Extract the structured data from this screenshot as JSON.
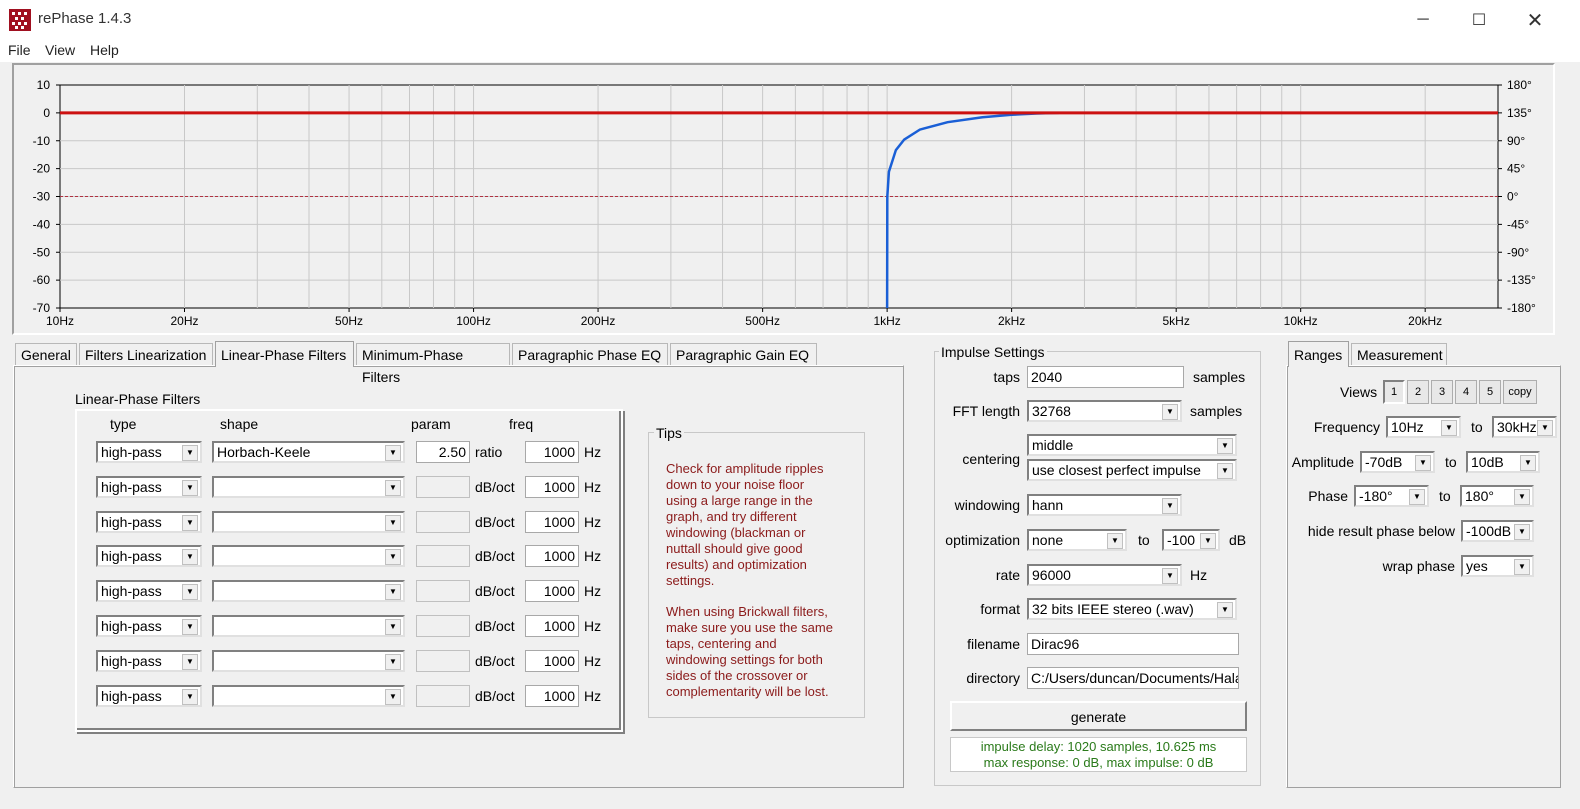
{
  "window": {
    "title": "rePhase 1.4.3",
    "minimize_icon": "minimize-icon",
    "maximize_icon": "maximize-icon",
    "close_icon": "close-icon"
  },
  "menu": [
    "File",
    "View",
    "Help"
  ],
  "graph": {
    "y_left_ticks": [
      "10",
      "0",
      "-10",
      "-20",
      "-30",
      "-40",
      "-50",
      "-60",
      "-70"
    ],
    "y_right_ticks": [
      "180°",
      "135°",
      "90°",
      "45°",
      "0°",
      "-45°",
      "-90°",
      "-135°",
      "-180°"
    ],
    "x_ticks": [
      "10Hz",
      "20Hz",
      "50Hz",
      "100Hz",
      "200Hz",
      "500Hz",
      "1kHz",
      "2kHz",
      "5kHz",
      "10kHz",
      "20kHz"
    ],
    "amplitude_color": "#cc1111",
    "phase_color": "#1a5fd6",
    "reference_color": "#b03040"
  },
  "chart_data": {
    "type": "line",
    "x_scale": "log",
    "xlim_hz": [
      10,
      30000
    ],
    "ylim_db": [
      -70,
      10
    ],
    "ylim_phase_deg": [
      -180,
      180
    ],
    "grid": true,
    "series": [
      {
        "x": [
          10,
          30000
        ],
        "y_db": [
          0,
          0
        ]
      },
      {
        "x": [
          1000,
          1001,
          1010,
          1050,
          1100,
          1200,
          1400,
          1700,
          2000,
          2300,
          2600
        ],
        "y_phase_deg": [
          -180,
          0,
          40,
          75,
          92,
          108,
          120,
          128,
          132,
          134,
          135
        ]
      },
      {
        "x": [
          10,
          30000
        ],
        "y_db": [
          -30,
          -30
        ]
      }
    ]
  },
  "tabs": [
    "General",
    "Filters Linearization",
    "Linear-Phase Filters",
    "Minimum-Phase Filters",
    "Paragraphic Phase EQ",
    "Paragraphic Gain EQ"
  ],
  "linear_phase": {
    "section_title": "Linear-Phase Filters",
    "headers": {
      "type": "type",
      "shape": "shape",
      "param": "param",
      "freq": "freq"
    },
    "rows": [
      {
        "type": "high-pass",
        "shape": "Horbach-Keele",
        "param": "2.50",
        "unit": "ratio",
        "freq": "1000",
        "hz": "Hz"
      },
      {
        "type": "high-pass",
        "shape": "",
        "param": "",
        "unit": "dB/oct",
        "freq": "1000",
        "hz": "Hz"
      },
      {
        "type": "high-pass",
        "shape": "",
        "param": "",
        "unit": "dB/oct",
        "freq": "1000",
        "hz": "Hz"
      },
      {
        "type": "high-pass",
        "shape": "",
        "param": "",
        "unit": "dB/oct",
        "freq": "1000",
        "hz": "Hz"
      },
      {
        "type": "high-pass",
        "shape": "",
        "param": "",
        "unit": "dB/oct",
        "freq": "1000",
        "hz": "Hz"
      },
      {
        "type": "high-pass",
        "shape": "",
        "param": "",
        "unit": "dB/oct",
        "freq": "1000",
        "hz": "Hz"
      },
      {
        "type": "high-pass",
        "shape": "",
        "param": "",
        "unit": "dB/oct",
        "freq": "1000",
        "hz": "Hz"
      },
      {
        "type": "high-pass",
        "shape": "",
        "param": "",
        "unit": "dB/oct",
        "freq": "1000",
        "hz": "Hz"
      }
    ]
  },
  "tips": {
    "title": "Tips",
    "lines1": [
      "Check for amplitude ripples",
      "down to your noise floor",
      "using a large range in the",
      "graph, and try different",
      "windowing (blackman or",
      "nuttall should give good",
      "results) and optimization",
      "settings."
    ],
    "lines2": [
      "When using Brickwall filters,",
      "make sure you use the same",
      "taps, centering and",
      "windowing settings for both",
      "sides of the crossover or",
      "complementarity will be lost."
    ]
  },
  "impulse": {
    "title": "Impulse Settings",
    "taps_label": "taps",
    "taps": "2040",
    "taps_unit": "samples",
    "fft_label": "FFT length",
    "fft": "32768",
    "fft_unit": "samples",
    "centering_label": "centering",
    "centering1": "middle",
    "centering2": "use closest perfect impulse",
    "windowing_label": "windowing",
    "windowing": "hann",
    "optimization_label": "optimization",
    "optimization": "none",
    "opt_to": "to",
    "opt_value": "-100",
    "opt_unit": "dB",
    "rate_label": "rate",
    "rate": "96000",
    "rate_unit": "Hz",
    "format_label": "format",
    "format": "32 bits IEEE stereo (.wav)",
    "filename_label": "filename",
    "filename": "Dirac96",
    "directory_label": "directory",
    "directory": "C:/Users/duncan/Documents/Hala",
    "generate": "generate",
    "status1": "impulse delay: 1020 samples, 10.625 ms",
    "status2": "max response: 0 dB, max impulse: 0 dB"
  },
  "ranges_tabs": [
    "Ranges",
    "Measurement"
  ],
  "ranges": {
    "views_label": "Views",
    "views": [
      "1",
      "2",
      "3",
      "4",
      "5",
      "copy"
    ],
    "freq_label": "Frequency",
    "freq_from": "10Hz",
    "freq_to_label": "to",
    "freq_to": "30kHz",
    "amp_label": "Amplitude",
    "amp_from": "-70dB",
    "amp_to_label": "to",
    "amp_to": "10dB",
    "phase_label": "Phase",
    "phase_from": "-180°",
    "phase_to_label": "to",
    "phase_to": "180°",
    "hide_label": "hide result phase below",
    "hide_value": "-100dB",
    "wrap_label": "wrap phase",
    "wrap_value": "yes"
  }
}
